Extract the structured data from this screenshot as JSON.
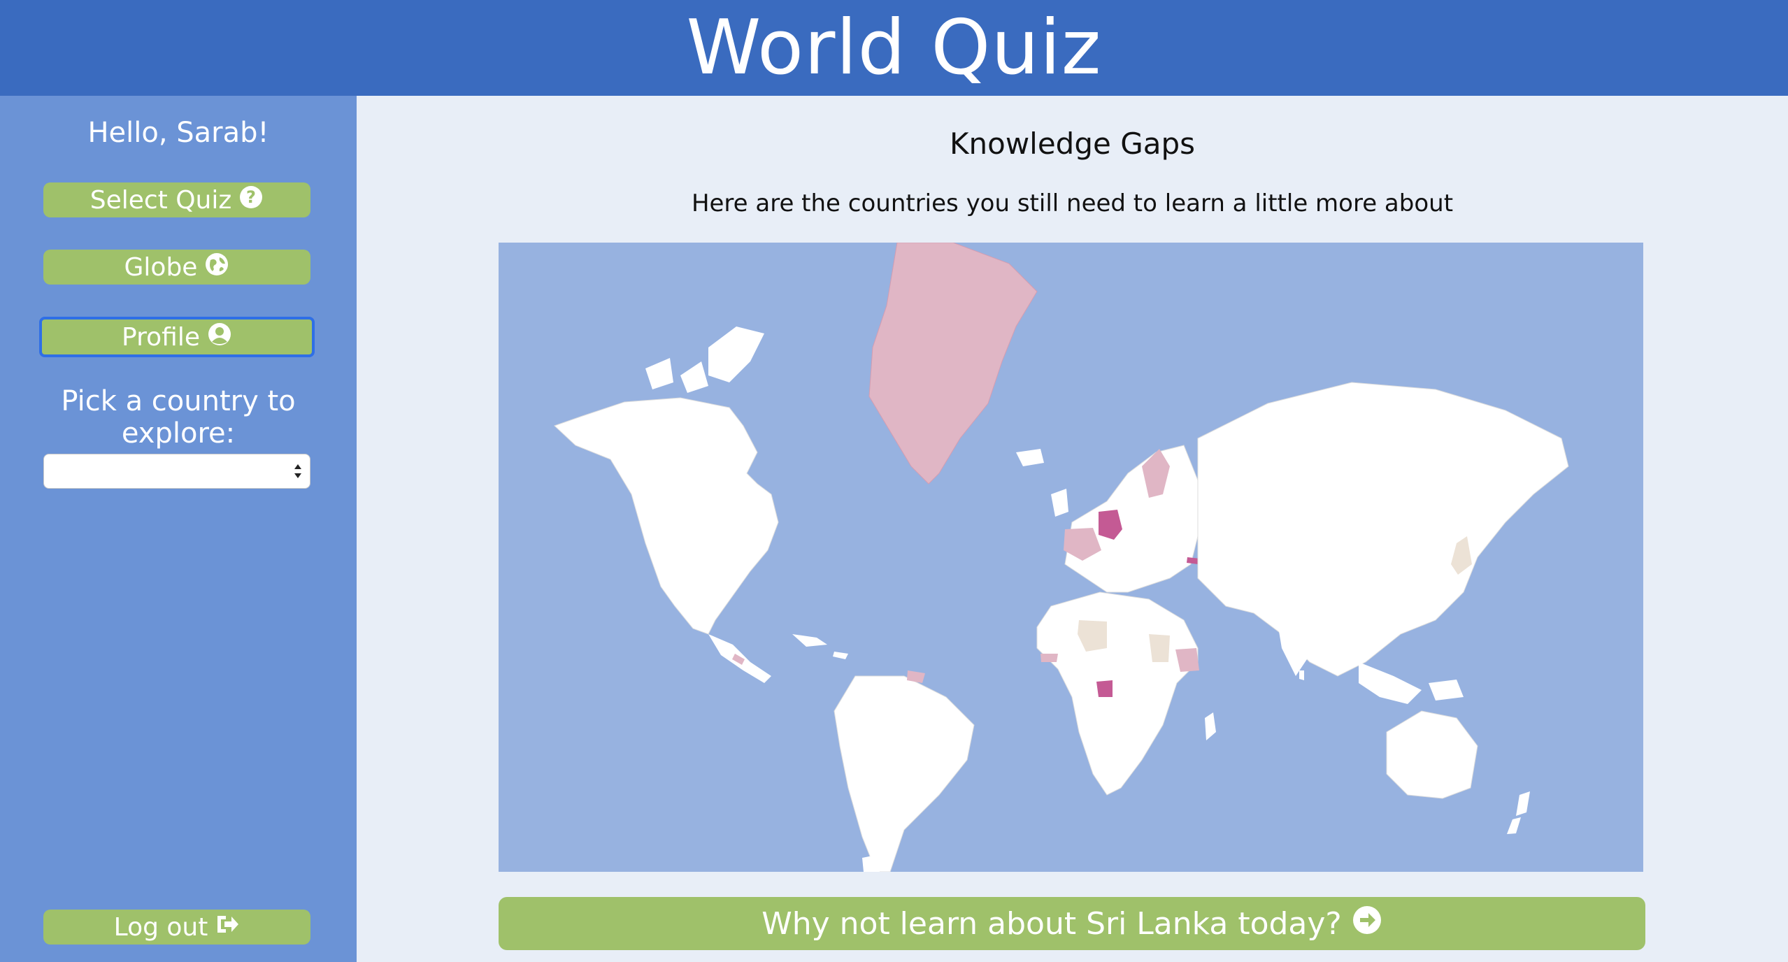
{
  "header": {
    "title": "World Quiz"
  },
  "sidebar": {
    "greeting": "Hello, Sarab!",
    "buttons": {
      "select_quiz": "Select Quiz",
      "globe": "Globe",
      "profile": "Profile",
      "logout": "Log out"
    },
    "pick_label": "Pick a country to explore:",
    "country_select_value": ""
  },
  "main": {
    "heading": "Knowledge Gaps",
    "subtitle": "Here are the countries you still need to learn a little more about",
    "learn_button": "Why not learn about Sri Lanka today?"
  },
  "colors": {
    "header": "#3a6bbf",
    "sidebar": "#6b93d6",
    "main_bg": "#e8eef7",
    "button_green": "#9fc16a",
    "ocean": "#97b2e0",
    "land": "#ffffff",
    "gap_light": "#e0b6c5",
    "gap_strong": "#c45a94",
    "gap_neutral": "#ece2d6"
  }
}
